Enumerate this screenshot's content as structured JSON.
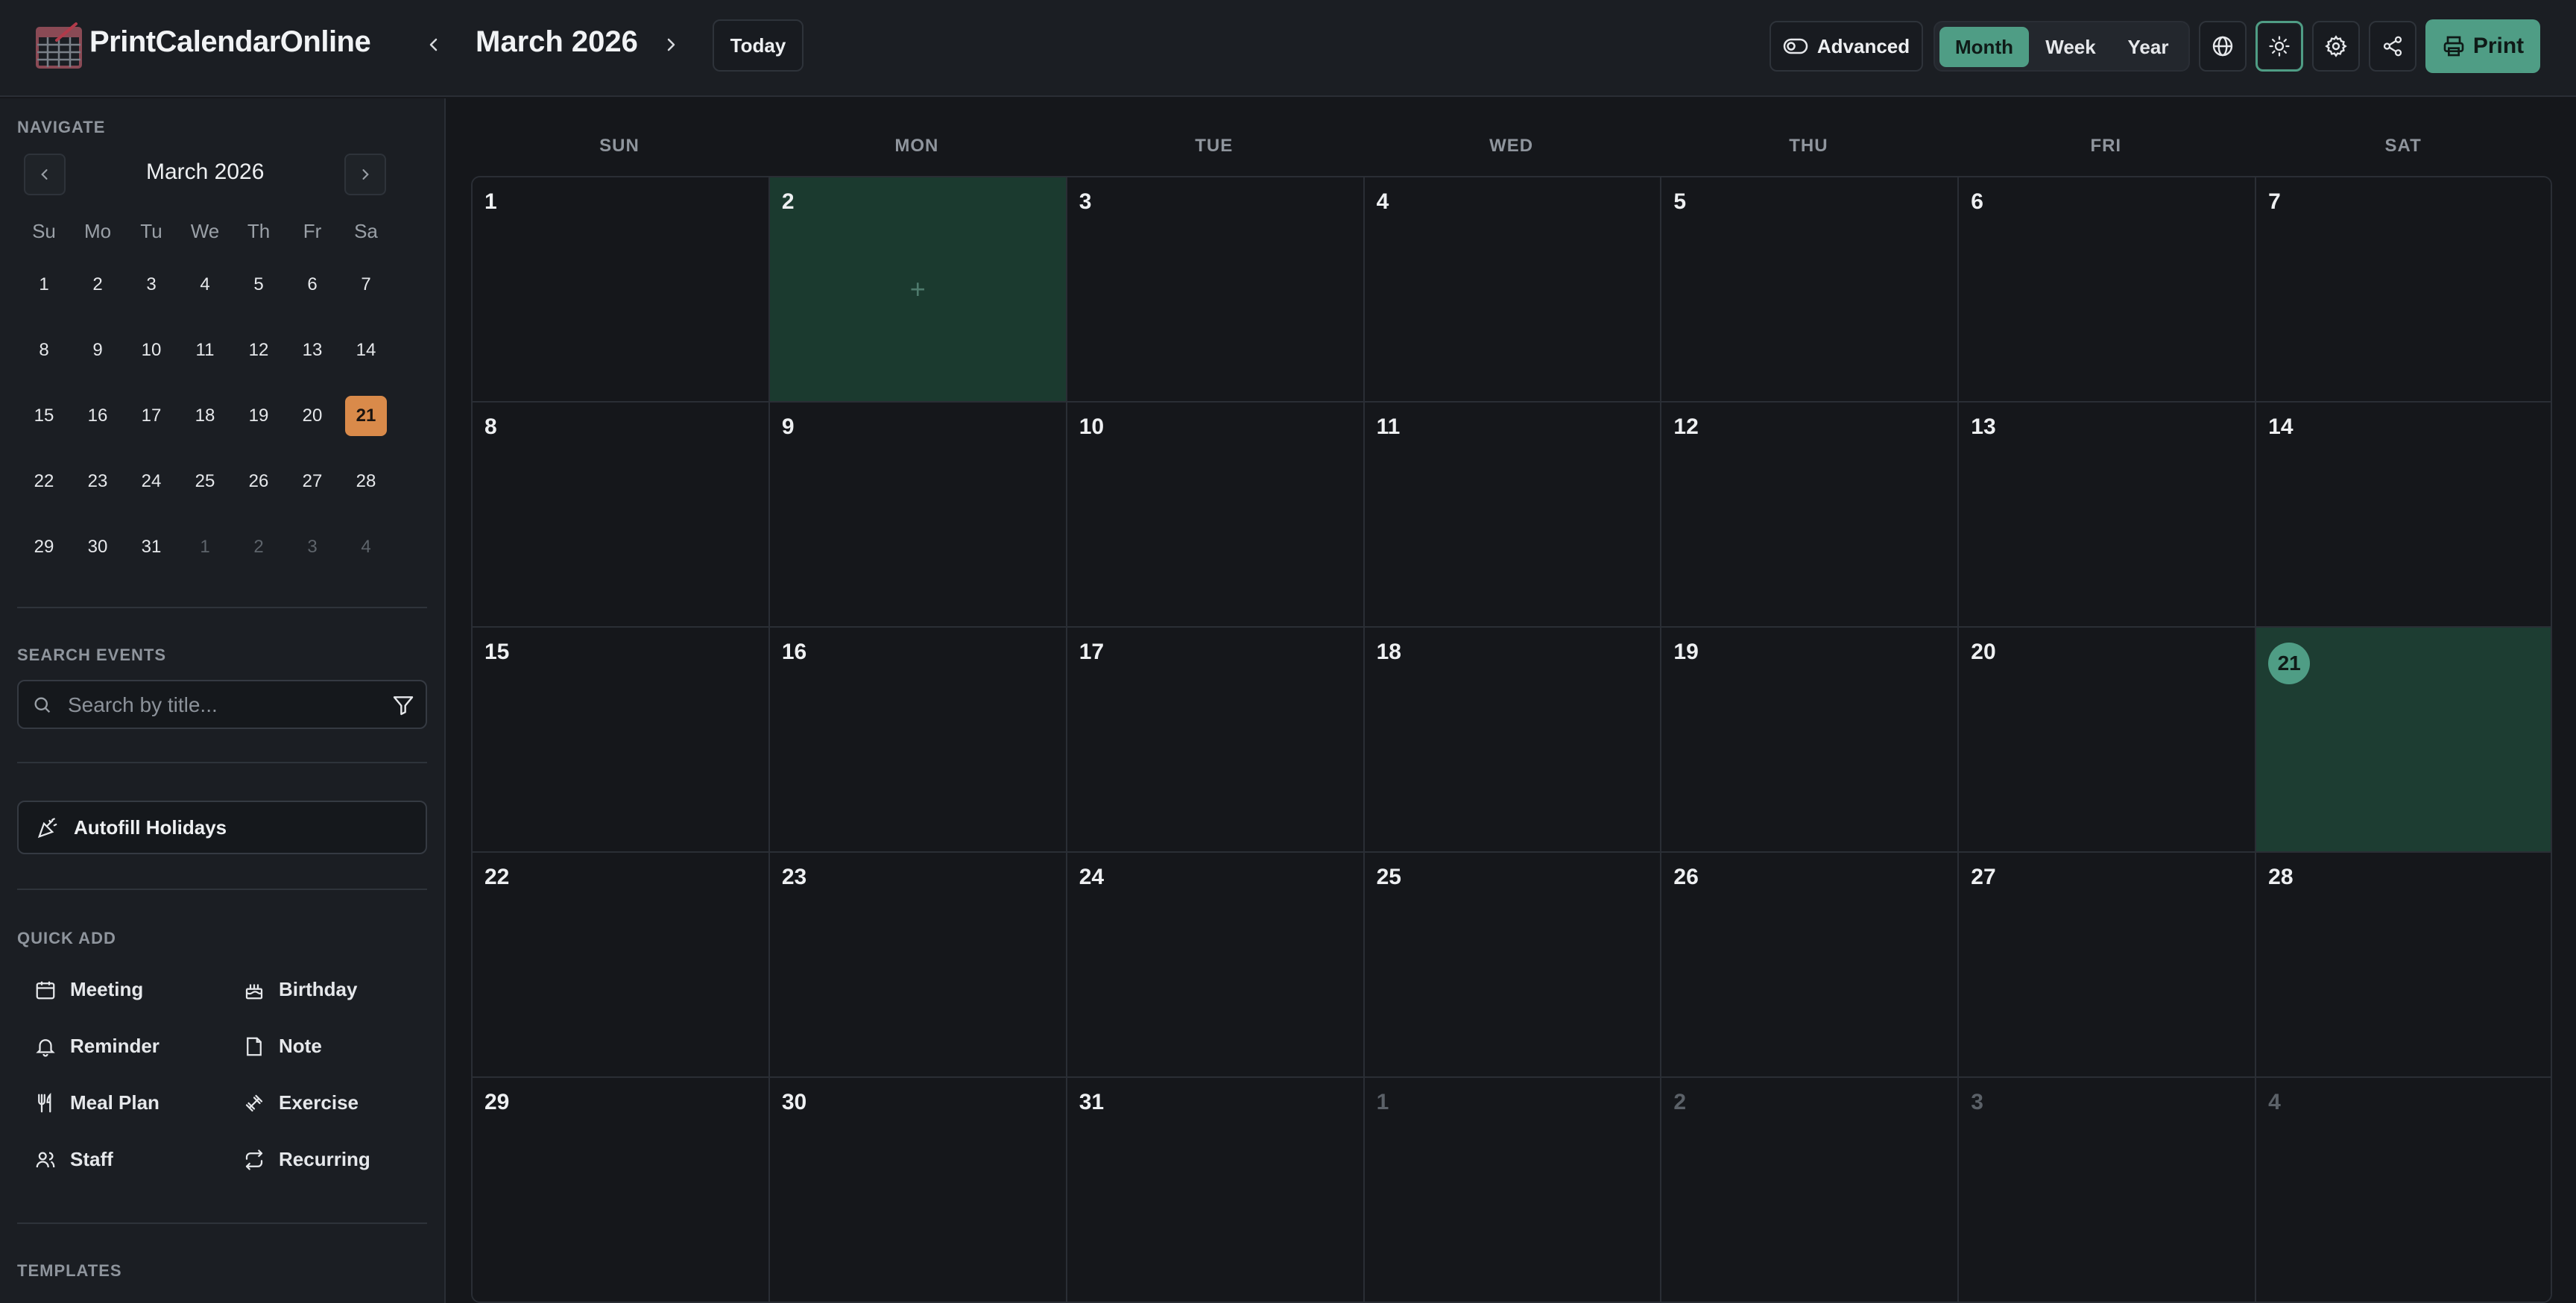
{
  "header": {
    "brand": "PrintCalendarOnline",
    "title": "March 2026",
    "today_label": "Today",
    "advanced_label": "Advanced",
    "views": [
      "Month",
      "Week",
      "Year"
    ],
    "active_view": "Month",
    "print_label": "Print"
  },
  "sidebar": {
    "navigate_label": "NAVIGATE",
    "mini_title": "March 2026",
    "weekdays": [
      "Su",
      "Mo",
      "Tu",
      "We",
      "Th",
      "Fr",
      "Sa"
    ],
    "weeks": [
      [
        "1",
        "2",
        "3",
        "4",
        "5",
        "6",
        "7"
      ],
      [
        "8",
        "9",
        "10",
        "11",
        "12",
        "13",
        "14"
      ],
      [
        "15",
        "16",
        "17",
        "18",
        "19",
        "20",
        "21"
      ],
      [
        "22",
        "23",
        "24",
        "25",
        "26",
        "27",
        "28"
      ],
      [
        "29",
        "30",
        "31",
        "1",
        "2",
        "3",
        "4"
      ]
    ],
    "selected_day": "21",
    "search_label": "SEARCH EVENTS",
    "search_placeholder": "Search by title...",
    "autofill_label": "Autofill Holidays",
    "quick_add_label": "QUICK ADD",
    "quick_add": [
      {
        "label": "Meeting",
        "icon": "calendar-icon"
      },
      {
        "label": "Birthday",
        "icon": "cake-icon"
      },
      {
        "label": "Reminder",
        "icon": "bell-icon"
      },
      {
        "label": "Note",
        "icon": "note-icon"
      },
      {
        "label": "Meal Plan",
        "icon": "utensils-icon"
      },
      {
        "label": "Exercise",
        "icon": "dumbbell-icon"
      },
      {
        "label": "Staff",
        "icon": "users-icon"
      },
      {
        "label": "Recurring",
        "icon": "repeat-icon"
      }
    ],
    "templates_label": "TEMPLATES"
  },
  "calendar": {
    "weekday_headers": [
      "SUN",
      "MON",
      "TUE",
      "WED",
      "THU",
      "FRI",
      "SAT"
    ],
    "weeks": [
      [
        "1",
        "2",
        "3",
        "4",
        "5",
        "6",
        "7"
      ],
      [
        "8",
        "9",
        "10",
        "11",
        "12",
        "13",
        "14"
      ],
      [
        "15",
        "16",
        "17",
        "18",
        "19",
        "20",
        "21"
      ],
      [
        "22",
        "23",
        "24",
        "25",
        "26",
        "27",
        "28"
      ],
      [
        "29",
        "30",
        "31",
        "1",
        "2",
        "3",
        "4"
      ]
    ],
    "today": "21",
    "hovered_day": "2",
    "add_glyph": "+"
  },
  "colors": {
    "accent": "#4f9d85",
    "selected_mini": "#d98a4a",
    "today_bg": "#1d3d32"
  }
}
